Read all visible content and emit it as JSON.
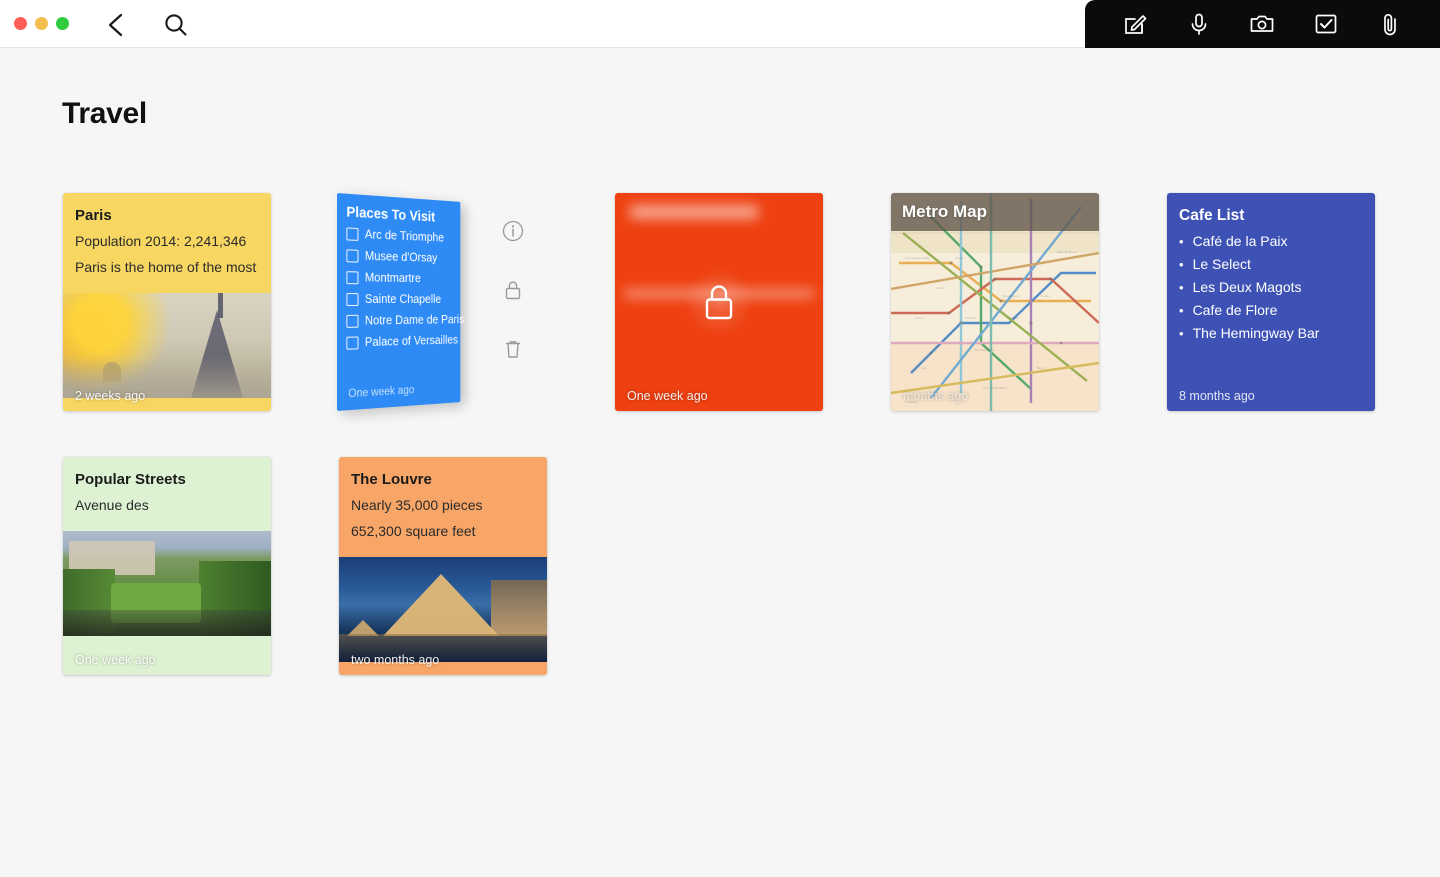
{
  "window": {
    "traffic_lights": [
      "close",
      "minimize",
      "zoom"
    ],
    "back_label": "back-chevron",
    "search_label": "search"
  },
  "toolbar": {
    "items": [
      {
        "name": "compose-icon",
        "label": "Compose"
      },
      {
        "name": "microphone-icon",
        "label": "Record Audio"
      },
      {
        "name": "camera-icon",
        "label": "Camera"
      },
      {
        "name": "checklist-icon",
        "label": "Checklist"
      },
      {
        "name": "attachment-icon",
        "label": "Attach File"
      }
    ]
  },
  "page": {
    "title": "Travel"
  },
  "drag_actions": [
    {
      "name": "info-icon",
      "label": "Info"
    },
    {
      "name": "lock-icon",
      "label": "Lock"
    },
    {
      "name": "trash-icon",
      "label": "Delete"
    }
  ],
  "cards": {
    "paris": {
      "title": "Paris",
      "line1": "Population 2014: 2,241,346",
      "line2": "Paris is the home of the most",
      "timestamp": "2 weeks ago",
      "color": "#F7D762"
    },
    "places": {
      "title": "Places To Visit",
      "items": [
        "Arc de Triomphe",
        "Musee d'Orsay",
        "Montmartre",
        "Sainte Chapelle",
        "Notre Dame de Paris",
        "Palace of Versailles"
      ],
      "timestamp": "One week ago",
      "color": "#2E8BF5"
    },
    "locked": {
      "title": "English To French",
      "timestamp": "One week ago",
      "color": "#EE4010",
      "state": "locked"
    },
    "metro": {
      "title": "Metro Map",
      "timestamp": "months ago",
      "color": "#F3E6CF"
    },
    "cafe": {
      "title": "Cafe List",
      "items": [
        "Café de la Paix",
        "Le Select",
        "Les Deux Magots",
        "Cafe de Flore",
        "The Hemingway Bar"
      ],
      "bullet": "•",
      "timestamp": "8 months ago",
      "color": "#3D52B4"
    },
    "streets": {
      "title": "Popular Streets",
      "line1": "Avenue des",
      "timestamp": "One week ago",
      "color": "#DDF2D2"
    },
    "louvre": {
      "title": "The Louvre",
      "line1": "Nearly 35,000 pieces",
      "line2": "652,300 square feet",
      "timestamp": "two months ago",
      "color": "#F7A668"
    }
  }
}
